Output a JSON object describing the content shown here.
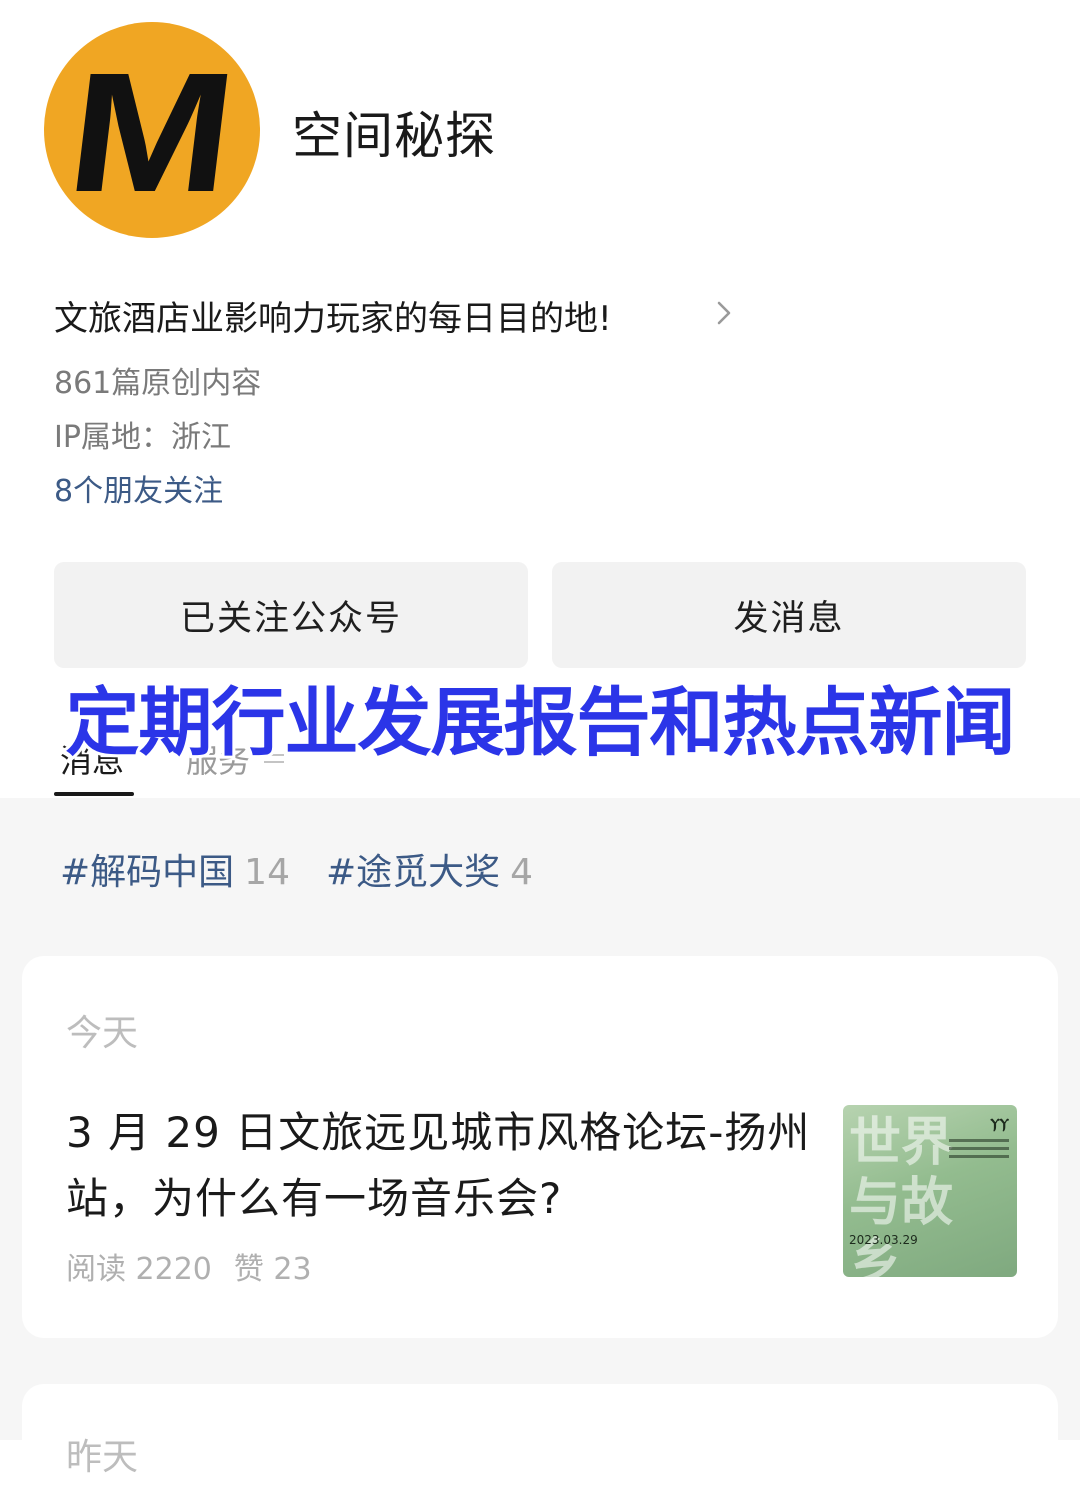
{
  "profile": {
    "avatar_letter": "M",
    "avatar_color": "#f0a623",
    "name": "空间秘探",
    "bio": "文旅酒店业影响力玩家的每日目的地!",
    "original_count": "861篇原创内容",
    "ip_location": "IP属地：浙江",
    "friends_following": "8个朋友关注"
  },
  "actions": {
    "follow_label": "已关注公众号",
    "message_label": "发消息"
  },
  "tabs": [
    {
      "label": "消息",
      "active": true
    },
    {
      "label": "服务",
      "active": false
    }
  ],
  "overlay_banner": "定期行业发展报告和热点新闻",
  "tags": [
    {
      "label": "#解码中国",
      "count": "14"
    },
    {
      "label": "#途觅大奖",
      "count": "4"
    }
  ],
  "feed": [
    {
      "date_label": "今天",
      "article": {
        "title": "3 月 29 日文旅远见城市风格论坛-扬州站，为什么有一场音乐会?",
        "reads": "阅读 2220",
        "likes": "赞 23",
        "thumbnail": {
          "calligraphy": "世界与故乡",
          "date": "2023.03.29"
        }
      }
    },
    {
      "date_label": "昨天"
    }
  ],
  "colors": {
    "link_blue": "#3c5a86",
    "banner_blue": "#2b35e8",
    "button_bg": "#f2f2f2",
    "section_bg": "#f6f6f6"
  }
}
